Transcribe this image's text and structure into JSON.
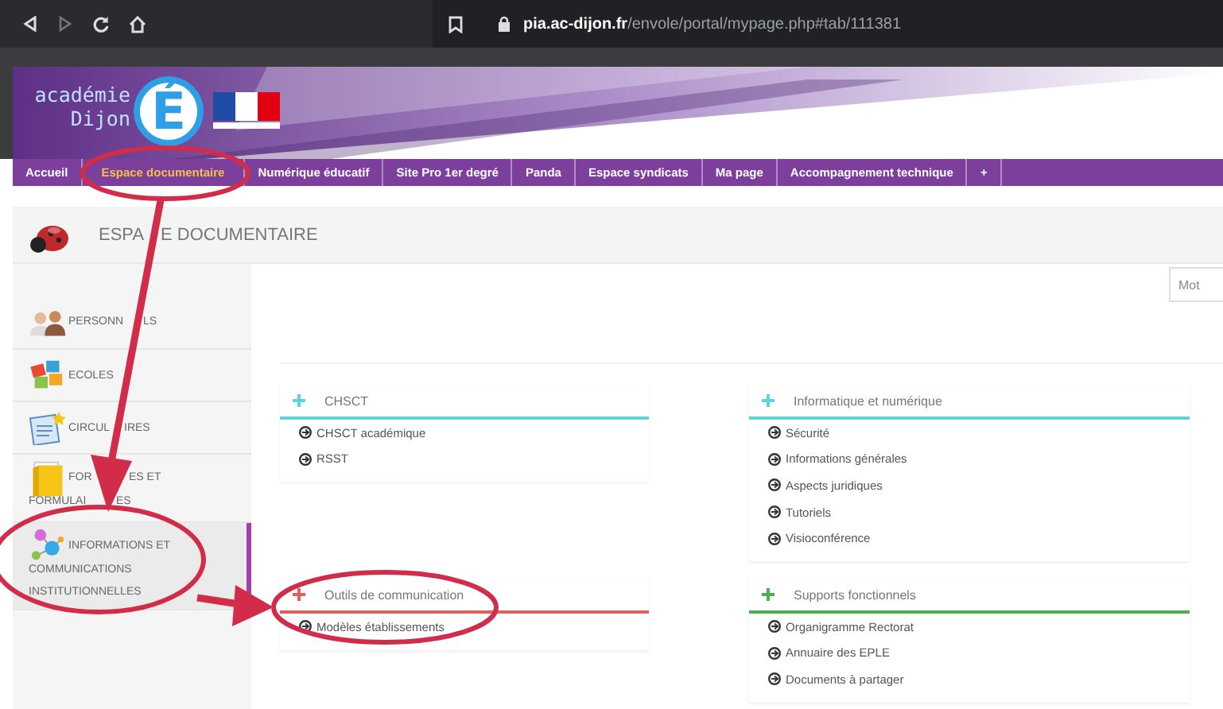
{
  "browser": {
    "url": "**pia.ac-dijon.fr**/envole/portal/mypage.php#tab/111381"
  },
  "banner": {
    "logo_line_1": "académie",
    "logo_line_2": "Dijon",
    "logo_letter": "É"
  },
  "nav": [
    {
      "label": "Accueil",
      "selected": false
    },
    {
      "label": "Espace documentaire",
      "selected": true
    },
    {
      "label": "Numérique éducatif",
      "selected": false
    },
    {
      "label": "Site Pro 1er degré",
      "selected": false
    },
    {
      "label": "Panda",
      "selected": false
    },
    {
      "label": "Espace syndicats",
      "selected": false
    },
    {
      "label": "Ma page",
      "selected": false
    },
    {
      "label": "Accompagnement technique",
      "selected": false
    },
    {
      "label": "+",
      "selected": false
    }
  ],
  "page_title": [
    "ESPA",
    "E DOCUMENTAIRE"
  ],
  "sidebar": {
    "items": [
      {
        "lines": [
          [
            "PERSONN",
            "LS"
          ]
        ],
        "selected": false
      },
      {
        "lines": [
          [
            "ECOLES"
          ]
        ],
        "selected": false
      },
      {
        "lines": [
          [
            "CIRCUL",
            "IRES"
          ]
        ],
        "selected": false
      },
      {
        "lines": [
          [
            "FOR",
            "ES ET"
          ],
          [
            "FORMULAI",
            "ES"
          ]
        ],
        "selected": false
      },
      {
        "lines": [
          [
            "INFORMATIONS ET"
          ],
          [
            "COMMUNICATIONS"
          ],
          [
            "INSTITUTIONNELLES"
          ]
        ],
        "selected": true
      }
    ]
  },
  "search": {
    "placeholder": "Mot"
  },
  "columns": [
    {
      "panels": [
        {
          "title": "CHSCT",
          "color": "#5fd3dc",
          "links": [
            "CHSCT académique",
            "RSST"
          ]
        },
        {
          "title": "Outils de communication",
          "color": "#e06060",
          "links": [
            "Modèles établissements"
          ]
        }
      ]
    },
    {
      "panels": [
        {
          "title": "Informatique et numérique",
          "color": "#5fd3dc",
          "links": [
            "Sécurité",
            "Informations générales",
            "Aspects juridiques",
            "Tutoriels",
            "Visioconférence"
          ]
        },
        {
          "title": "Supports fonctionnels",
          "color": "#4caf50",
          "links": [
            "Organigramme Rectorat",
            "Annuaire des EPLE",
            "Documents à partager"
          ]
        }
      ]
    }
  ]
}
